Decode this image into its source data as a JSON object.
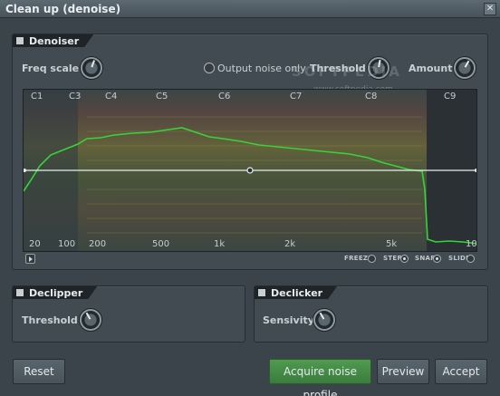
{
  "window": {
    "title": "Clean up (denoise)",
    "close_label": "✕"
  },
  "denoiser": {
    "label": "Denoiser",
    "freq_scale_label": "Freq scale",
    "output_noise_only_label": "Output noise only",
    "threshold_label": "Threshold",
    "amount_label": "Amount",
    "watermark": "SOFTPEDIA",
    "watermark_url": "www.softpedia.com",
    "note_labels": [
      "C1",
      "C3",
      "C4",
      "C5",
      "C6",
      "C7",
      "C8",
      "C9"
    ],
    "freq_labels": [
      "20",
      "100",
      "200",
      "500",
      "1k",
      "2k",
      "5k",
      "10"
    ],
    "options": {
      "freeze": "FREEZE",
      "step": "STEP",
      "snap": "SNAP",
      "slide": "SLIDE"
    }
  },
  "declipper": {
    "label": "Declipper",
    "threshold_label": "Threshold"
  },
  "declicker": {
    "label": "Declicker",
    "sensivity_label": "Sensivity"
  },
  "buttons": {
    "reset": "Reset",
    "acquire": "Acquire noise profile",
    "preview": "Preview",
    "accept": "Accept"
  },
  "colors": {
    "accent_green": "#3c8a3e",
    "curve_green": "#37d33a",
    "background": "#3b444a"
  }
}
